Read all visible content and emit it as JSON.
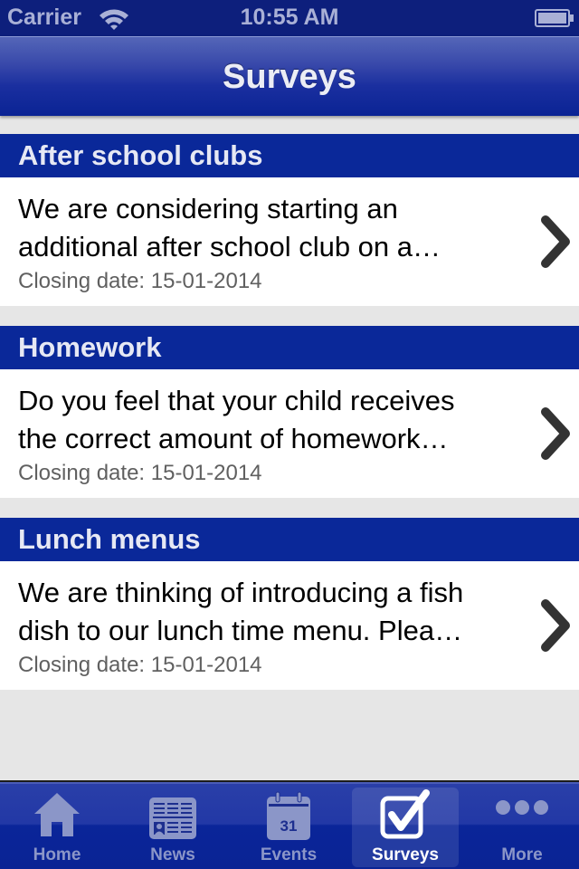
{
  "status_bar": {
    "carrier": "Carrier",
    "time": "10:55 AM",
    "wifi_icon": "wifi-icon",
    "battery_icon": "battery-icon"
  },
  "nav_bar": {
    "title": "Surveys"
  },
  "surveys": [
    {
      "title": "After school clubs",
      "description_line1": "We are considering starting an",
      "description_line2": "additional after school club on a…",
      "closing_date": "Closing date: 15-01-2014",
      "accessory_icon": "chevron-right-icon"
    },
    {
      "title": "Homework",
      "description_line1": "Do you feel that your child receives",
      "description_line2": "the correct amount of homework…",
      "closing_date": "Closing date: 15-01-2014",
      "accessory_icon": "chevron-right-icon"
    },
    {
      "title": "Lunch menus",
      "description_line1": "We are thinking of introducing a fish",
      "description_line2": "dish to our lunch time menu.  Plea…",
      "closing_date": "Closing date: 15-01-2014",
      "accessory_icon": "chevron-right-icon"
    }
  ],
  "tab_bar": {
    "active_tab": "Surveys",
    "tabs": [
      {
        "label": "Home",
        "icon": "home-icon"
      },
      {
        "label": "News",
        "icon": "newspaper-icon"
      },
      {
        "label": "Events",
        "icon": "calendar-icon",
        "calendar_day": "31"
      },
      {
        "label": "Surveys",
        "icon": "checkbox-icon"
      },
      {
        "label": "More",
        "icon": "more-icon"
      }
    ]
  },
  "colors": {
    "status_bar_bg": "#0d1f7c",
    "section_header_bg": "#0a2899",
    "content_bg": "#e6e6e6",
    "cell_bg": "#ffffff",
    "date_text": "#606060",
    "tab_inactive": "#8b96c8",
    "tab_active": "#ffffff"
  }
}
